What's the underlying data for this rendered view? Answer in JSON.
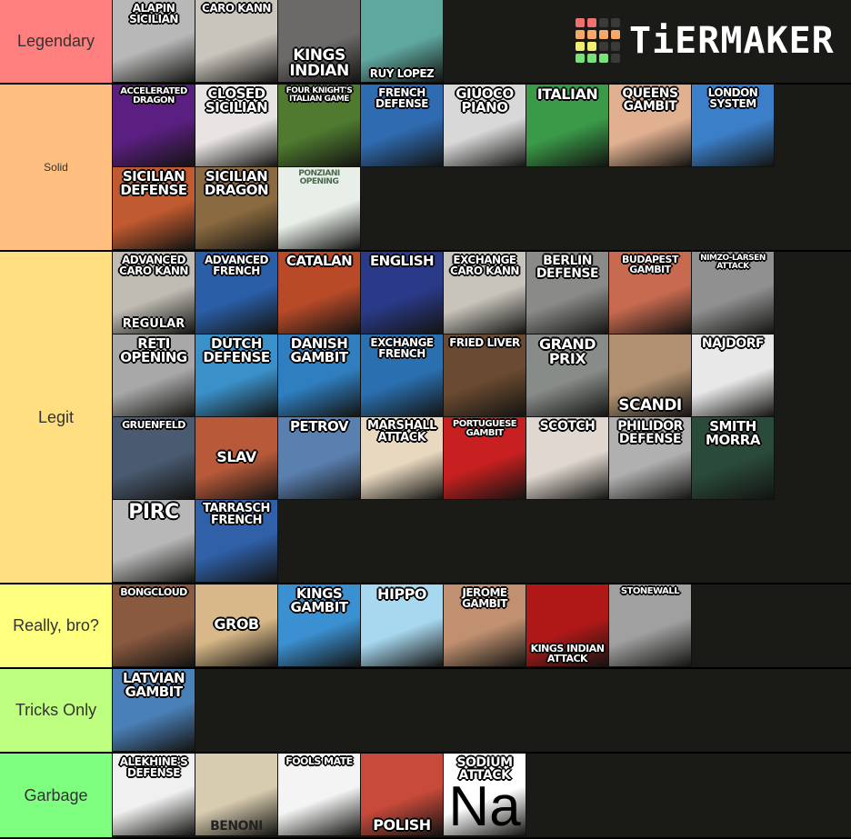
{
  "logo": {
    "text": "TiERMAKER",
    "grid_colors": [
      "#f07070",
      "#f07070",
      "#3a3a3a",
      "#3a3a3a",
      "#f5a86a",
      "#f5a86a",
      "#f5a86a",
      "#f5a86a",
      "#f0f070",
      "#f0f070",
      "#3a3a3a",
      "#3a3a3a",
      "#7ae07a",
      "#7ae07a",
      "#7ae07a",
      "#3a3a3a"
    ]
  },
  "tiers": [
    {
      "label": "Legendary",
      "color": "#ff7f7f",
      "items": [
        {
          "caption": "ALAPIN SICILIAN",
          "pos": "top",
          "bg": "#b8b8b8",
          "size": 12
        },
        {
          "caption": "CARO KANN",
          "pos": "top",
          "bg": "#c9c4bc",
          "size": 12
        },
        {
          "caption": "KINGS INDIAN",
          "pos": "bottom",
          "bg": "#6c6a68",
          "size": 17
        },
        {
          "caption": "RUY LOPEZ",
          "pos": "bottom",
          "bg": "#5fa8a0",
          "size": 12
        }
      ]
    },
    {
      "label": "Solid",
      "color": "#ffbf7f",
      "small": true,
      "items": [
        {
          "caption": "ACCELERATED DRAGON",
          "pos": "top",
          "bg": "#5a1f80",
          "size": 10
        },
        {
          "caption": "CLOSED SICILIAN",
          "pos": "top",
          "bg": "#e8e4e4",
          "size": 15
        },
        {
          "caption": "FOUR KNIGHT'S ITALIAN GAME",
          "pos": "top",
          "bg": "#4f7a30",
          "size": 9
        },
        {
          "caption": "FRENCH DEFENSE",
          "pos": "top",
          "bg": "#2f6bb0",
          "size": 12
        },
        {
          "caption": "GIUOCO PIANO",
          "pos": "top",
          "bg": "#d8d8d8",
          "size": 15
        },
        {
          "caption": "ITALIAN",
          "pos": "top",
          "bg": "#3a9a48",
          "size": 16
        },
        {
          "caption": "QUEENS GAMBIT",
          "pos": "top",
          "bg": "#e0b090",
          "size": 14
        },
        {
          "caption": "LONDON SYSTEM",
          "pos": "top",
          "bg": "#3b7fc8",
          "size": 12
        },
        {
          "caption": "SICILIAN DEFENSE",
          "pos": "top",
          "bg": "#c05a30",
          "size": 15
        },
        {
          "caption": "SICILIAN DRAGON",
          "pos": "top",
          "bg": "#8a6a40",
          "size": 15
        },
        {
          "caption": "PONZIANI OPENING",
          "pos": "top",
          "bg": "#e8eee8",
          "size": 9,
          "dark": true
        }
      ]
    },
    {
      "label": "Legit",
      "color": "#ffdf7f",
      "items": [
        {
          "caption": "ADVANCED CARO KANN",
          "pos": "top",
          "bg": "#c0bcb4",
          "size": 12,
          "sub": "REGULAR"
        },
        {
          "caption": "ADVANCED FRENCH",
          "pos": "top",
          "bg": "#2a5fa8",
          "size": 12
        },
        {
          "caption": "CATALAN",
          "pos": "top",
          "bg": "#b84a28",
          "size": 15
        },
        {
          "caption": "ENGLISH",
          "pos": "top",
          "bg": "#2a3a88",
          "size": 15
        },
        {
          "caption": "EXCHANGE CARO KANN",
          "pos": "top",
          "bg": "#c8c4bc",
          "size": 12
        },
        {
          "caption": "BERLIN DEFENSE",
          "pos": "top",
          "bg": "#8a8a88",
          "size": 14
        },
        {
          "caption": "BUDAPEST GAMBIT",
          "pos": "top",
          "bg": "#c86a50",
          "size": 11
        },
        {
          "caption": "NIMZO-LARSEN ATTACK",
          "pos": "top",
          "bg": "#909090",
          "size": 9
        },
        {
          "caption": "RETI OPENING",
          "pos": "top",
          "bg": "#a8a8a8",
          "size": 15
        },
        {
          "caption": "DUTCH DEFENSE",
          "pos": "top",
          "bg": "#3a90c8",
          "size": 15
        },
        {
          "caption": "DANISH GAMBIT",
          "pos": "top",
          "bg": "#2f7fc0",
          "size": 15
        },
        {
          "caption": "EXCHANGE FRENCH",
          "pos": "top",
          "bg": "#2a6fb0",
          "size": 12
        },
        {
          "caption": "FRIED LIVER",
          "pos": "top",
          "bg": "#6a4a30",
          "size": 12
        },
        {
          "caption": "GRAND PRIX",
          "pos": "top",
          "bg": "#888c88",
          "size": 16
        },
        {
          "caption": "SCANDI",
          "pos": "bottom",
          "bg": "#b09070",
          "size": 17
        },
        {
          "caption": "NAJDORF",
          "pos": "top",
          "bg": "#e8e8e8",
          "size": 14
        },
        {
          "caption": "GRUENFELD",
          "pos": "top",
          "bg": "#4a5a70",
          "size": 11
        },
        {
          "caption": "SLAV",
          "pos": "middle",
          "bg": "#b85a3a",
          "size": 16
        },
        {
          "caption": "PETROV",
          "pos": "top",
          "bg": "#5a80b0",
          "size": 15
        },
        {
          "caption": "MARSHALL ATTACK",
          "pos": "top",
          "bg": "#e8d8c0",
          "size": 13
        },
        {
          "caption": "PORTUGUESE GAMBIT",
          "pos": "top",
          "bg": "#c82020",
          "size": 10
        },
        {
          "caption": "SCOTCH",
          "pos": "top",
          "bg": "#e0d8d0",
          "size": 14
        },
        {
          "caption": "PHILIDOR DEFENSE",
          "pos": "top",
          "bg": "#b0b0b0",
          "size": 14
        },
        {
          "caption": "SMITH MORRA",
          "pos": "top",
          "bg": "#2a4a3a",
          "size": 15
        },
        {
          "caption": "PIRC",
          "pos": "top",
          "bg": "#b8b8b8",
          "size": 22
        },
        {
          "caption": "TARRASCH FRENCH",
          "pos": "top",
          "bg": "#2f60a8",
          "size": 13
        }
      ]
    },
    {
      "label": "Really, bro?",
      "color": "#ffff7f",
      "items": [
        {
          "caption": "BONGCLOUD",
          "pos": "top",
          "bg": "#8a5a40",
          "size": 11
        },
        {
          "caption": "GROB",
          "pos": "middle",
          "bg": "#d8b888",
          "size": 16
        },
        {
          "caption": "KINGS GAMBIT",
          "pos": "top",
          "bg": "#3a90d0",
          "size": 15
        },
        {
          "caption": "HIPPO",
          "pos": "top",
          "bg": "#a8d8f0",
          "size": 16
        },
        {
          "caption": "JEROME GAMBIT",
          "pos": "top",
          "bg": "#c09070",
          "size": 12
        },
        {
          "caption": "KINGS INDIAN ATTACK",
          "pos": "bottom",
          "bg": "#b01818",
          "size": 11
        },
        {
          "caption": "STONEWALL",
          "pos": "top",
          "bg": "#a0a0a0",
          "size": 10
        }
      ]
    },
    {
      "label": "Tricks Only",
      "color": "#bfff7f",
      "items": [
        {
          "caption": "LATVIAN GAMBIT",
          "pos": "top",
          "bg": "#4a80b8",
          "size": 15
        }
      ]
    },
    {
      "label": "Garbage",
      "color": "#7fff7f",
      "items": [
        {
          "caption": "ALEKHINE'S DEFENSE",
          "pos": "top",
          "bg": "#f0f0f0",
          "size": 12
        },
        {
          "caption": "BENONI",
          "pos": "bottom",
          "bg": "#d8ccb0",
          "size": 14,
          "dark": true
        },
        {
          "caption": "FOOLS MATE",
          "pos": "top",
          "bg": "#f4f4f4",
          "size": 11
        },
        {
          "caption": "POLISH",
          "pos": "bottom",
          "bg": "#c84a3a",
          "size": 16
        },
        {
          "caption": "SODIUM ATTACK",
          "pos": "top",
          "bg": "#ffffff",
          "size": 14,
          "sub": "Na",
          "sub_big": true
        }
      ]
    }
  ]
}
